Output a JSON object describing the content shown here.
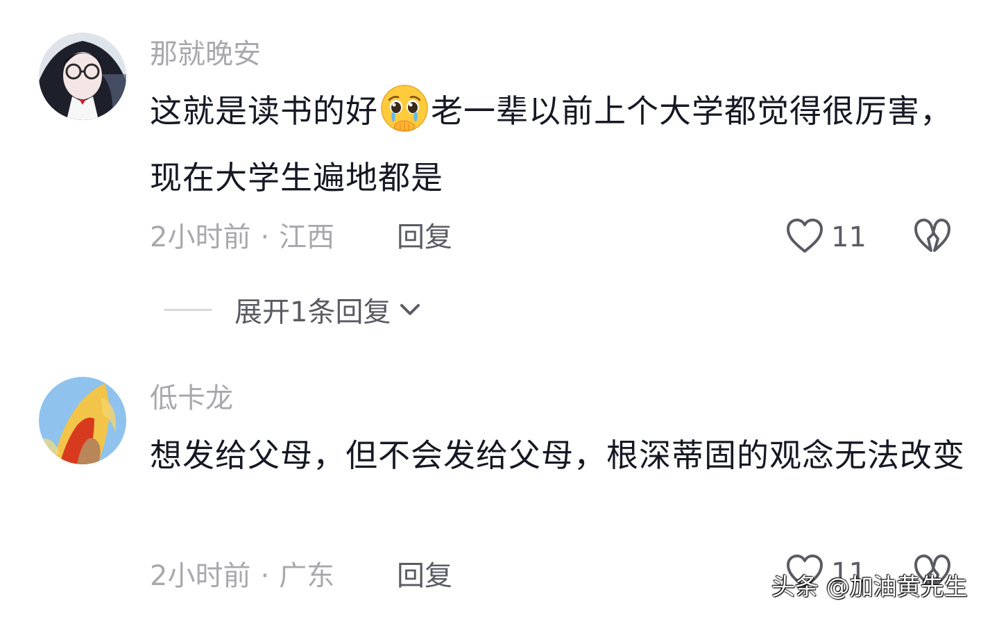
{
  "comments": [
    {
      "username": "那就晚安",
      "text_part1": "这就是读书的好",
      "emoji": "pleading-face-with-tears",
      "text_part2": "老一辈以前上个大学都觉得很厉害，现在大学生遍地都是",
      "time": "2小时前",
      "dot": "·",
      "location": "江西",
      "reply_label": "回复",
      "like_count": "11"
    },
    {
      "username": "低卡龙",
      "text": "想发给父母，但不会发给父母，根深蒂固的观念无法改变",
      "time": "2小时前",
      "dot": "·",
      "location": "广东",
      "reply_label": "回复",
      "like_count": "11"
    }
  ],
  "expand_replies": {
    "label": "展开1条回复"
  },
  "watermark": "头条 @加油黄先生",
  "colors": {
    "primary_text": "#161823",
    "secondary_text": "#a8a8ad",
    "action_text": "#5a5b63"
  }
}
